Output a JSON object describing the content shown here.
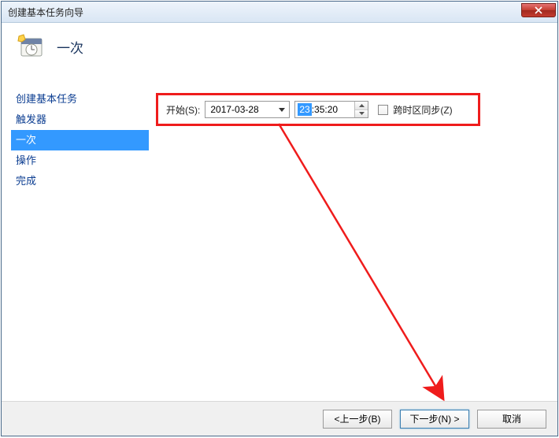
{
  "window_title": "创建基本任务向导",
  "header": {
    "title": "一次"
  },
  "sidebar": {
    "items": [
      {
        "label": "创建基本任务"
      },
      {
        "label": "触发器"
      },
      {
        "label": "一次",
        "selected": true
      },
      {
        "label": "操作"
      },
      {
        "label": "完成"
      }
    ]
  },
  "form": {
    "start_label": "开始(S):",
    "date_value": "2017-03-28",
    "time_hour_sel": "23",
    "time_rest": ":35:20",
    "tz_sync_label": "跨时区同步(Z)"
  },
  "footer": {
    "back": "<上一步(B)",
    "next": "下一步(N) >",
    "cancel": "取消"
  }
}
